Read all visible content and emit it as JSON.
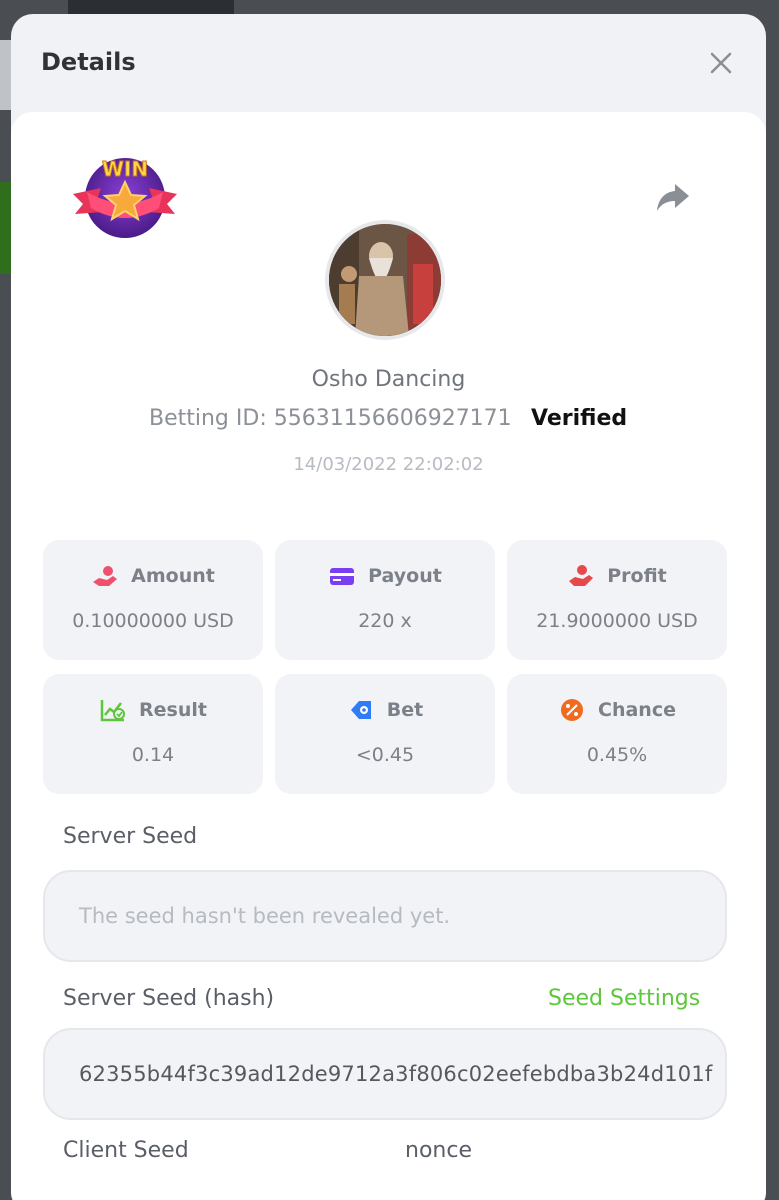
{
  "modal": {
    "title": "Details",
    "game_name": "Osho Dancing",
    "betting_id": "Betting ID: 55631156606927171",
    "verified": "Verified",
    "timestamp": "14/03/2022 22:02:02",
    "win_badge_text": "WIN"
  },
  "stats": [
    {
      "label": "Amount",
      "value": "0.10000000 USD",
      "icon": "hand-coin-icon",
      "color": "#f0506e"
    },
    {
      "label": "Payout",
      "value": "220 x",
      "icon": "card-icon",
      "color": "#7b3ff2"
    },
    {
      "label": "Profit",
      "value": "21.9000000 USD",
      "icon": "hand-user-icon",
      "color": "#e64949"
    },
    {
      "label": "Result",
      "value": "0.14",
      "icon": "chart-check-icon",
      "color": "#5cc73b"
    },
    {
      "label": "Bet",
      "value": "<0.45",
      "icon": "target-icon",
      "color": "#2f7cf6"
    },
    {
      "label": "Chance",
      "value": "0.45%",
      "icon": "percent-icon",
      "color": "#f06b1d"
    }
  ],
  "server_seed": {
    "label": "Server Seed",
    "placeholder": "The seed hasn't been revealed yet."
  },
  "server_seed_hash": {
    "label": "Server Seed (hash)",
    "settings_link": "Seed Settings",
    "value": "62355b44f3c39ad12de9712a3f806c02eefebdba3b24d101f"
  },
  "client_seed": {
    "label": "Client Seed",
    "nonce_label": "nonce"
  }
}
